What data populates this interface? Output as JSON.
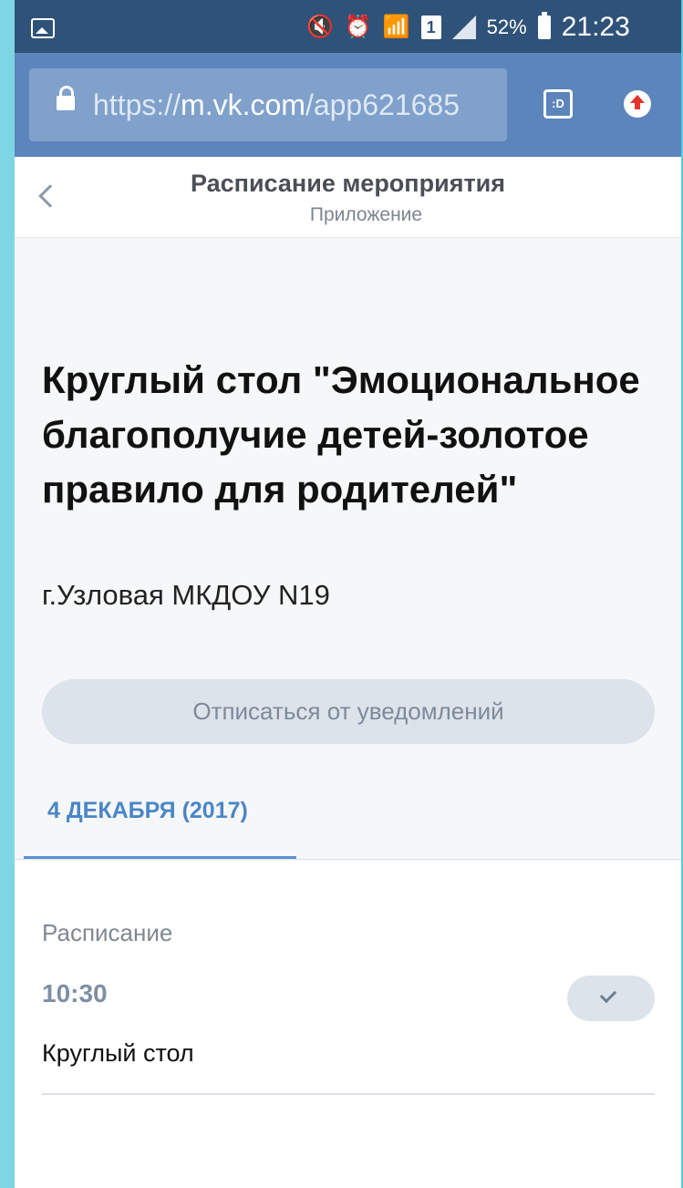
{
  "status_bar": {
    "battery_percent": "52%",
    "time": "21:23",
    "sim_slot": "1",
    "icons": [
      "gallery-icon",
      "mute-icon",
      "alarm-icon",
      "wifi-icon",
      "sim-icon",
      "signal-icon",
      "battery-icon"
    ]
  },
  "browser": {
    "url_scheme": "https://",
    "url_host": "m.vk.com",
    "url_path": "/app621685",
    "tab_button_label": ":D"
  },
  "app_header": {
    "title": "Расписание мероприятия",
    "subtitle": "Приложение"
  },
  "event": {
    "title": "Круглый стол \"Эмоциональное благополучие детей-золотое правило для родителей\"",
    "location": "г.Узловая МКДОУ N19",
    "unsubscribe_label": "Отписаться от уведомлений",
    "date_tab": "4 ДЕКАБРЯ (2017)"
  },
  "schedule": {
    "heading": "Расписание",
    "items": [
      {
        "time": "10:30",
        "name": "Круглый стол",
        "checked": true
      }
    ]
  },
  "colors": {
    "status_bar": "#2f5279",
    "browser_bar": "#5b85bb",
    "accent": "#4a86c7"
  }
}
